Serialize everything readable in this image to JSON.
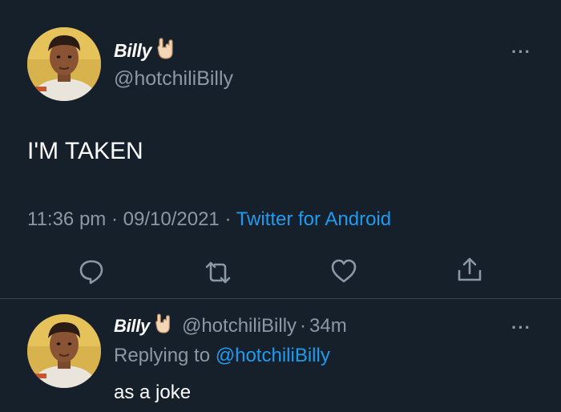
{
  "main_tweet": {
    "display_name": "Billy",
    "name_emoji": "rock-on-hand-emoji",
    "handle": "@hotchiliBilly",
    "text": "I'M TAKEN",
    "time": "11:36 pm",
    "date": "09/10/2021",
    "source": "Twitter for Android",
    "sep": "·",
    "more": "···"
  },
  "actions": [
    "reply-icon",
    "retweet-icon",
    "like-icon",
    "share-icon"
  ],
  "reply_tweet": {
    "display_name": "Billy",
    "name_emoji": "rock-on-hand-emoji",
    "handle": "@hotchiliBilly",
    "time_ago": "34m",
    "sep": "·",
    "replying_label": "Replying to",
    "replying_handle": "@hotchiliBilly",
    "text": "as a joke",
    "more": "···"
  },
  "colors": {
    "background": "#15202b",
    "text": "#ffffff",
    "secondary": "#8b98a5",
    "accent": "#1d9bf0",
    "divider": "#38444d"
  }
}
